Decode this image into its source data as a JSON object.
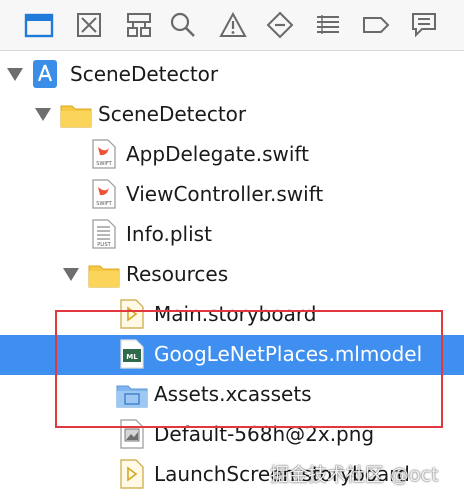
{
  "toolbar": {
    "icons": [
      "folder-icon",
      "target-icon",
      "hierarchy-icon",
      "search-icon",
      "warning-icon",
      "breakpoint-icon",
      "report-list-icon",
      "label-tag-icon",
      "message-icon"
    ],
    "selected_color": "#1f7ad9"
  },
  "navigator": {
    "items": [
      {
        "label": "SceneDetector",
        "icon": "project-icon",
        "expanded": true
      },
      {
        "label": "SceneDetector",
        "icon": "folder-icon",
        "expanded": true
      },
      {
        "label": "AppDelegate.swift",
        "icon": "swift-file-icon"
      },
      {
        "label": "ViewController.swift",
        "icon": "swift-file-icon"
      },
      {
        "label": "Info.plist",
        "icon": "plist-file-icon"
      },
      {
        "label": "Resources",
        "icon": "folder-icon",
        "expanded": true
      },
      {
        "label": "Main.storyboard",
        "icon": "storyboard-file-icon"
      },
      {
        "label": "GoogLeNetPlaces.mlmodel",
        "icon": "mlmodel-file-icon",
        "selected": true
      },
      {
        "label": "Assets.xcassets",
        "icon": "assets-folder-icon"
      },
      {
        "label": "Default-568h@2x.png",
        "icon": "image-file-icon"
      },
      {
        "label": "LaunchScreen.storyboard",
        "icon": "storyboard-file-icon"
      }
    ],
    "icon_labels": {
      "swift": "SWIFT",
      "plist": "PLIST",
      "mlmodel": "ML"
    }
  },
  "colors": {
    "selection": "#3f8ff0",
    "highlight_box": "#e0383e",
    "folder": "#f7c844"
  },
  "watermark": "掘金技术社区 @oct"
}
